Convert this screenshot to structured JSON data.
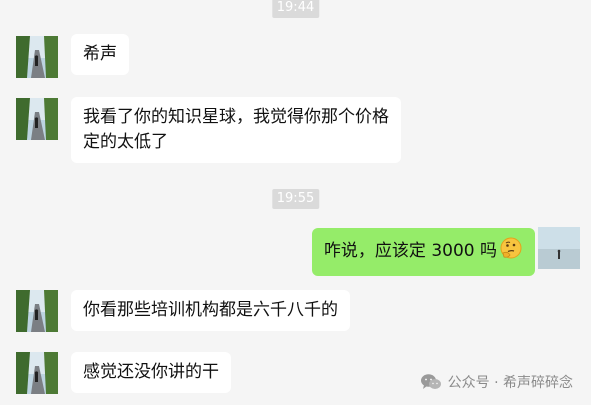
{
  "timestamps": [
    "19:44",
    "19:55"
  ],
  "messages": [
    {
      "side": "left",
      "text": "希声"
    },
    {
      "side": "left",
      "lines": [
        "我看了你的知识星球，我觉得你那个价格",
        "定的太低了"
      ]
    },
    {
      "side": "right",
      "text": "咋说，应该定 3000 吗",
      "emoji": "thinking-face-icon"
    },
    {
      "side": "left",
      "text": "你看那些培训机构都是六千八千的"
    },
    {
      "side": "left",
      "text": "感觉还没你讲的干"
    }
  ],
  "watermark": {
    "text": "公众号 · 希声碎碎念",
    "icon": "wechat-icon"
  },
  "colors": {
    "background": "#f5f5f5",
    "left_bubble": "#ffffff",
    "right_bubble": "#95ec69",
    "timestamp_bg": "#dadada"
  }
}
